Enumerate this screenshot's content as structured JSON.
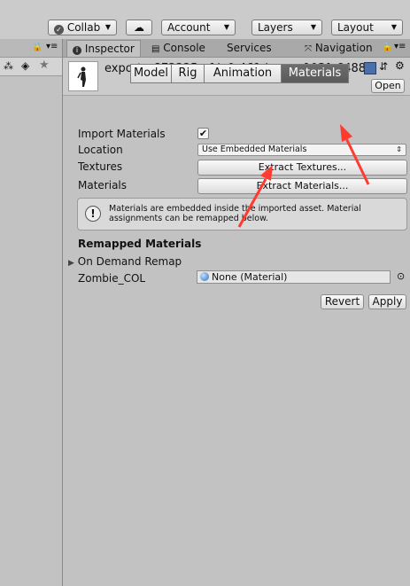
{
  "toolbar": {
    "collab_label": "Collab",
    "account_label": "Account",
    "layers_label": "Layers",
    "layout_label": "Layout"
  },
  "tabs": {
    "inspector": "Inspector",
    "console": "Console",
    "services": "Services",
    "navigation": "Navigation"
  },
  "asset": {
    "name": "export_c872225a-fde0-461d-aecc-103fe64882",
    "open_label": "Open"
  },
  "importer_tabs": [
    "Model",
    "Rig",
    "Animation",
    "Materials"
  ],
  "importer_tab_selected": "Materials",
  "materials": {
    "import_materials_label": "Import Materials",
    "import_materials_checked": true,
    "location_label": "Location",
    "location_value": "Use Embedded Materials",
    "textures_label": "Textures",
    "extract_textures_label": "Extract Textures...",
    "materials_label": "Materials",
    "extract_materials_label": "Extract Materials...",
    "info_text_line1": "Materials are embedded inside the imported asset. Material",
    "info_text_line2": "assignments can be remapped below.",
    "remapped_header": "Remapped Materials",
    "on_demand_remap_label": "On Demand Remap",
    "slot_name": "Zombie_COL",
    "slot_value": "None (Material)"
  },
  "footer": {
    "revert_label": "Revert",
    "apply_label": "Apply"
  },
  "colors": {
    "annotation_arrow": "#ff3b30",
    "selected_tab": "#646464"
  }
}
